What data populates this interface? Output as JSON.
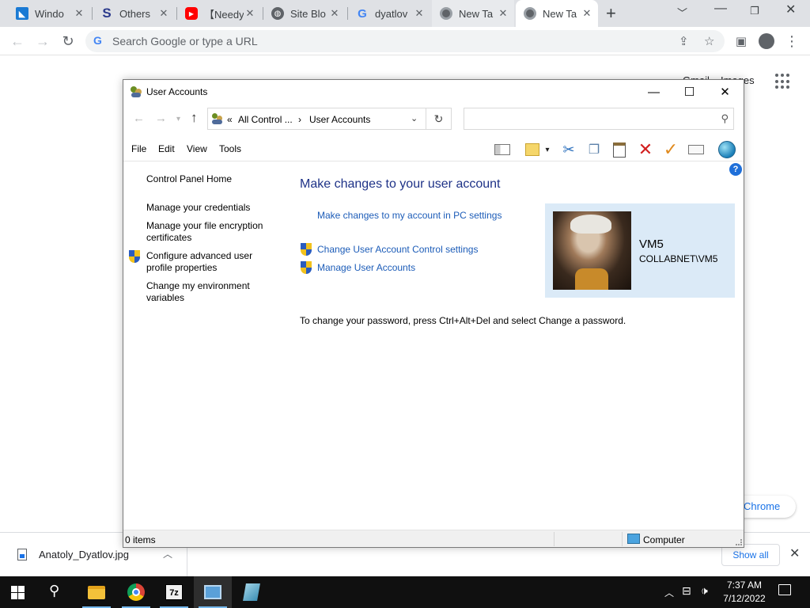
{
  "browser": {
    "tabs": [
      {
        "title": "Windo",
        "favicon": "windows-app-icon",
        "color": "#1a7ad4"
      },
      {
        "title": "Others",
        "favicon": "s-logo-icon",
        "color": "#2b3a8c"
      },
      {
        "title": "【Needy",
        "favicon": "youtube-icon",
        "color": "#ff0000"
      },
      {
        "title": "Site Blo",
        "favicon": "globe-icon",
        "color": "#5f6368"
      },
      {
        "title": "dyatlov",
        "favicon": "google-g-icon",
        "color": "#4285f4"
      },
      {
        "title": "New Ta",
        "favicon": "chrome-icon",
        "color": "#5f6368"
      },
      {
        "title": "New Ta",
        "favicon": "chrome-icon",
        "color": "#5f6368"
      }
    ],
    "omnibox": {
      "placeholder": "Search Google or type a URL"
    },
    "ntp": {
      "gmail": "Gmail",
      "images": "Images",
      "customize": "Chrome"
    },
    "downloads": {
      "file_name": "Anatoly_Dyatlov.jpg",
      "show_all": "Show all"
    }
  },
  "window": {
    "title": "User Accounts",
    "address": {
      "overflow": "«",
      "part1": "All Control ...",
      "separator": "›",
      "part2": "User Accounts"
    },
    "menu": [
      "File",
      "Edit",
      "View",
      "Tools"
    ],
    "left_pane": {
      "home": "Control Panel Home",
      "credentials": "Manage your credentials",
      "encryption": "Manage your file encryption certificates",
      "profile": "Configure advanced user profile properties",
      "env": "Change my environment variables"
    },
    "main": {
      "heading": "Make changes to your user account",
      "pc_settings": "Make changes to my account in PC settings",
      "uac": "Change User Account Control settings",
      "manage": "Manage User Accounts",
      "password_note": "To change your password, press Ctrl+Alt+Del and select Change a password."
    },
    "user": {
      "name": "VM5",
      "domain": "COLLABNET\\VM5"
    },
    "status": {
      "items": "0 items",
      "location": "Computer"
    }
  },
  "taskbar": {
    "time": "7:37 AM",
    "date": "7/12/2022"
  }
}
